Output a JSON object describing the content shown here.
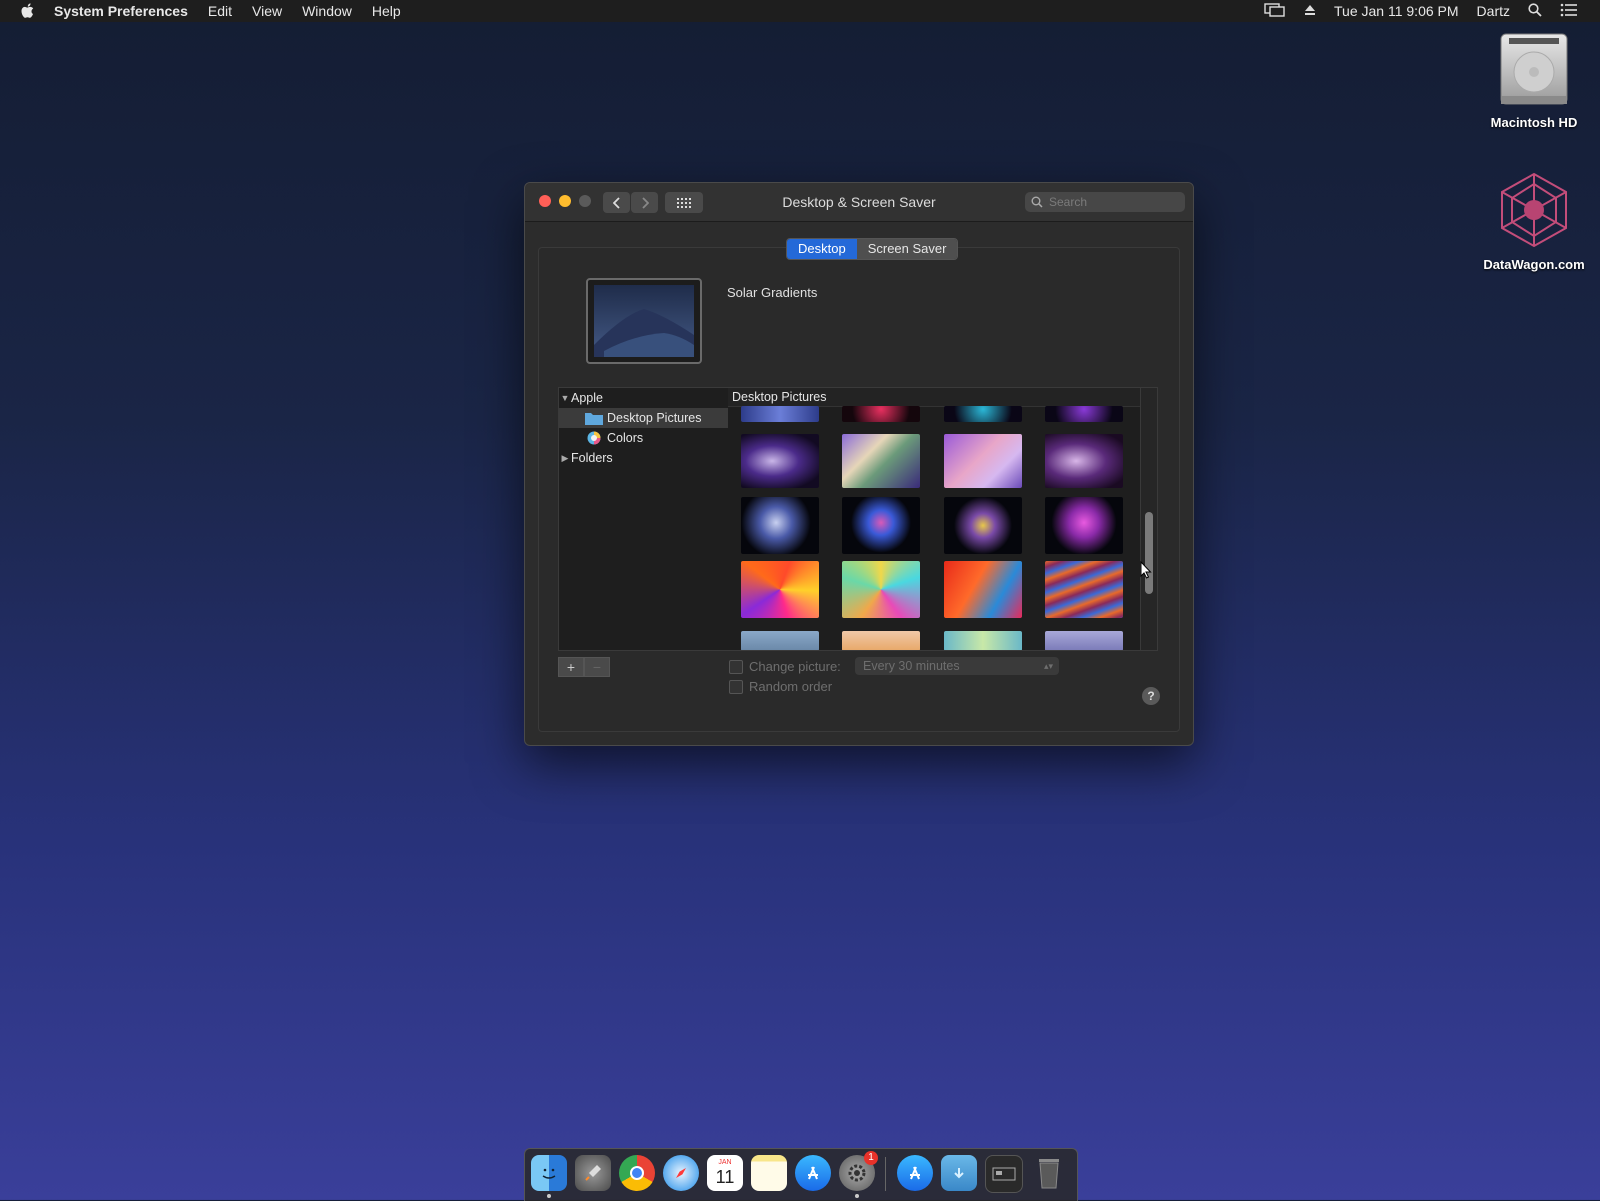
{
  "menubar": {
    "app_name": "System Preferences",
    "items": [
      "Edit",
      "View",
      "Window",
      "Help"
    ],
    "clock": "Tue Jan 11  9:06 PM",
    "user": "Dartz"
  },
  "desktop_icons": [
    {
      "label": "Macintosh HD",
      "icon": "hard-drive-icon"
    },
    {
      "label": "DataWagon.com",
      "icon": "datawagon-logo-icon"
    }
  ],
  "window": {
    "title": "Desktop & Screen Saver",
    "search_placeholder": "Search",
    "tabs": [
      {
        "label": "Desktop",
        "active": true
      },
      {
        "label": "Screen Saver",
        "active": false
      }
    ],
    "wallpaper_name": "Solar Gradients",
    "sources": {
      "apple_label": "Apple",
      "desktop_pictures_label": "Desktop Pictures",
      "colors_label": "Colors",
      "folders_label": "Folders"
    },
    "grid_header": "Desktop Pictures",
    "change_picture_label": "Change picture:",
    "interval_value": "Every 30 minutes",
    "random_order_label": "Random order",
    "help_label": "?",
    "add_label": "+",
    "remove_label": "−"
  },
  "dock": {
    "apps": [
      "Finder",
      "Launchpad",
      "Chrome",
      "Safari",
      "Calendar",
      "Notes",
      "App Store",
      "System Preferences",
      "App Store Downloads",
      "Downloads Folder",
      "Screenshot",
      "Trash"
    ],
    "calendar_month": "JAN",
    "calendar_day": "11",
    "sysprefs_badge": "1"
  },
  "colors": {
    "accent": "#2469d8",
    "close": "#ff5f57",
    "minimize": "#febc2e",
    "zoom": "#5a5a5a"
  }
}
